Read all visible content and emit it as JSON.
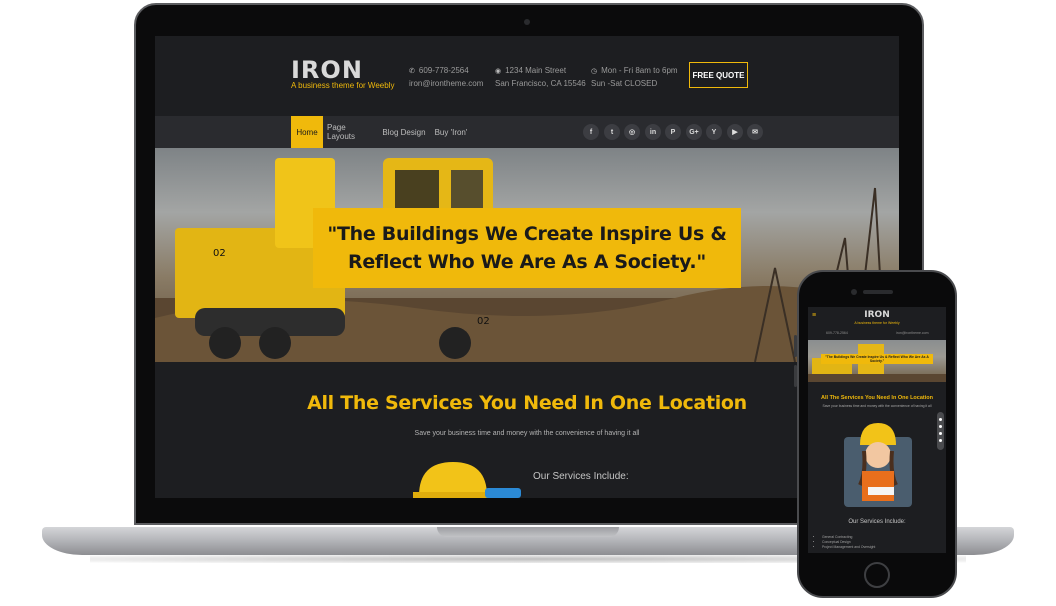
{
  "site": {
    "logo": "IRON",
    "tagline": "A business theme for Weebly",
    "phone": "609-778-2564",
    "email": "iron@irontheme.com",
    "address_line1": "1234 Main Street",
    "address_line2": "San Francisco, CA 15546",
    "hours_line1": "Mon - Fri 8am to 6pm",
    "hours_line2": "Sun -Sat CLOSED",
    "cta": "FREE QUOTE"
  },
  "nav": {
    "items": [
      {
        "label": "Home",
        "active": true
      },
      {
        "label": "Page Layouts",
        "active": false
      },
      {
        "label": "Blog Design",
        "active": false
      },
      {
        "label": "Buy 'Iron'",
        "active": false
      }
    ]
  },
  "social": [
    {
      "icon": "facebook-icon",
      "glyph": "f"
    },
    {
      "icon": "twitter-icon",
      "glyph": "t"
    },
    {
      "icon": "instagram-icon",
      "glyph": "◎"
    },
    {
      "icon": "linkedin-icon",
      "glyph": "in"
    },
    {
      "icon": "pinterest-icon",
      "glyph": "P"
    },
    {
      "icon": "google-plus-icon",
      "glyph": "G+"
    },
    {
      "icon": "yelp-icon",
      "glyph": "Y"
    },
    {
      "icon": "youtube-icon",
      "glyph": "▶"
    },
    {
      "icon": "mail-icon",
      "glyph": "✉"
    }
  ],
  "hero": {
    "quote_line1": "\"The Buildings We Create Inspire Us &",
    "quote_line2": "Reflect Who We Are As A Society.\""
  },
  "services": {
    "title": "All The Services You Need In One Location",
    "subtitle": "Save your business time and money with the convenience of having it all",
    "include_heading": "Our Services Include:"
  },
  "phone_view": {
    "menu_icon": "≡",
    "list": [
      "General Contracting",
      "Conceptual Design",
      "Project Management and Oversight"
    ]
  },
  "colors": {
    "accent": "#f0b90b",
    "background": "#1d1e21",
    "navbar": "#2a2b2f"
  }
}
